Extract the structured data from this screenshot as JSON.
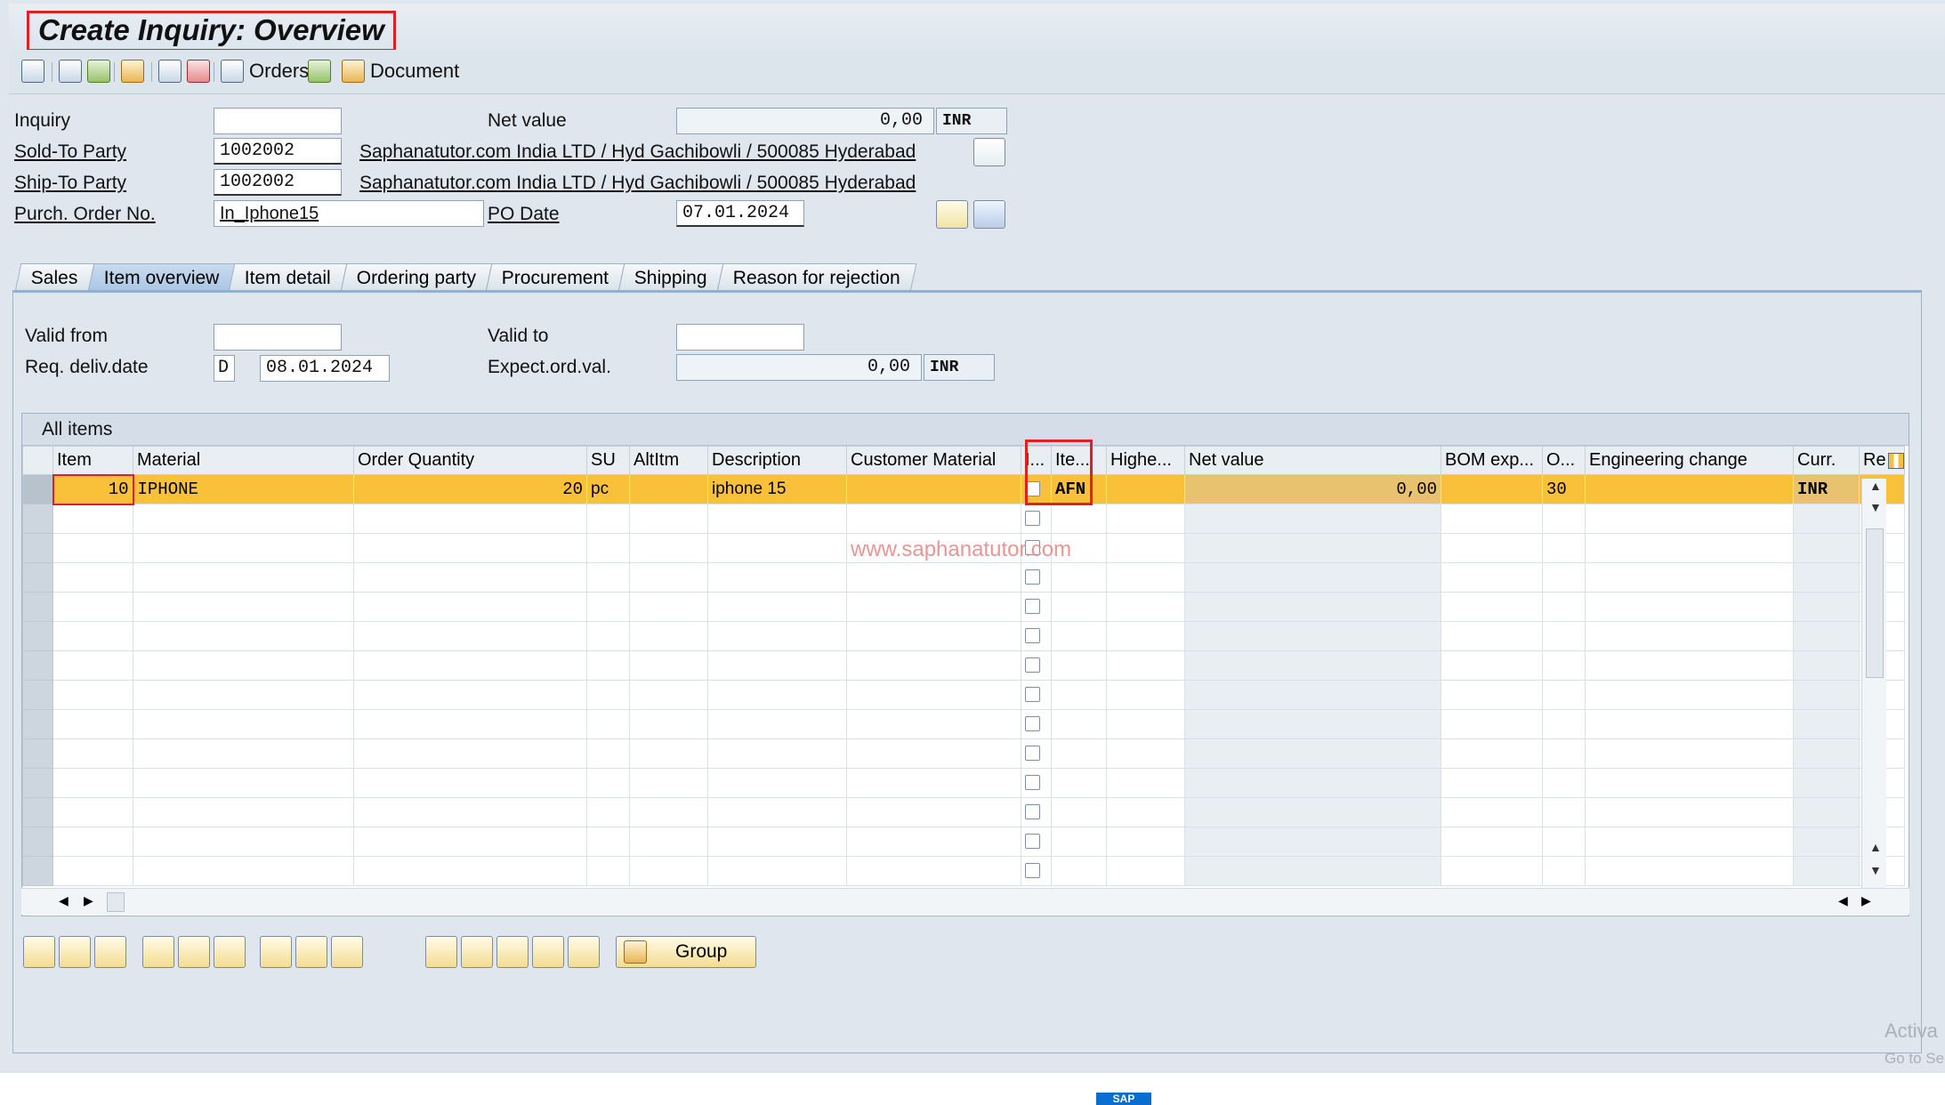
{
  "window": {
    "title": "Create Inquiry: Overview"
  },
  "toolbar": {
    "orders_label": "Orders",
    "document_label": "Document"
  },
  "header": {
    "inquiry_label": "Inquiry",
    "inquiry_value": "",
    "net_value_label": "Net value",
    "net_value": "0,00",
    "net_value_currency": "INR",
    "sold_to_label": "Sold-To Party",
    "sold_to_value": "1002002",
    "sold_to_desc": "Saphanatutor.com India LTD / Hyd Gachibowli / 500085 Hyderabad",
    "ship_to_label": "Ship-To Party",
    "ship_to_value": "1002002",
    "ship_to_desc": "Saphanatutor.com India LTD / Hyd Gachibowli / 500085 Hyderabad",
    "po_label": "Purch. Order No.",
    "po_value": "In_Iphone15",
    "po_date_label": "PO Date",
    "po_date_value": "07.01.2024"
  },
  "tabs": [
    "Sales",
    "Item overview",
    "Item detail",
    "Ordering party",
    "Procurement",
    "Shipping",
    "Reason for rejection"
  ],
  "active_tab": "Item overview",
  "overview": {
    "valid_from_label": "Valid from",
    "valid_from_value": "",
    "valid_to_label": "Valid to",
    "valid_to_value": "",
    "req_deliv_label": "Req. deliv.date",
    "req_deliv_type": "D",
    "req_deliv_value": "08.01.2024",
    "expect_ord_label": "Expect.ord.val.",
    "expect_ord_value": "0,00",
    "expect_ord_currency": "INR"
  },
  "grid": {
    "title": "All items",
    "columns": [
      "Item",
      "Material",
      "Order Quantity",
      "SU",
      "AltItm",
      "Description",
      "Customer Material",
      "I...",
      "Ite...",
      "Highe...",
      "Net value",
      "BOM exp...",
      "O...",
      "Engineering change",
      "Curr.",
      "Re"
    ],
    "rows": [
      {
        "item": "10",
        "material": "IPHONE",
        "qty": "20",
        "su": "pc",
        "altitm": "",
        "desc": "iphone 15",
        "cust_mat": "",
        "itcat": "AFN",
        "higher": "",
        "net": "0,00",
        "bom": "",
        "o": "30",
        "eng": "",
        "curr": "INR",
        "re": ""
      }
    ],
    "empty_rows": 13
  },
  "bottom": {
    "group_label": "Group"
  },
  "overlay": {
    "watermark": "www.saphanatutor.com",
    "activate_1": "Activa",
    "activate_2": "Go to Se"
  }
}
